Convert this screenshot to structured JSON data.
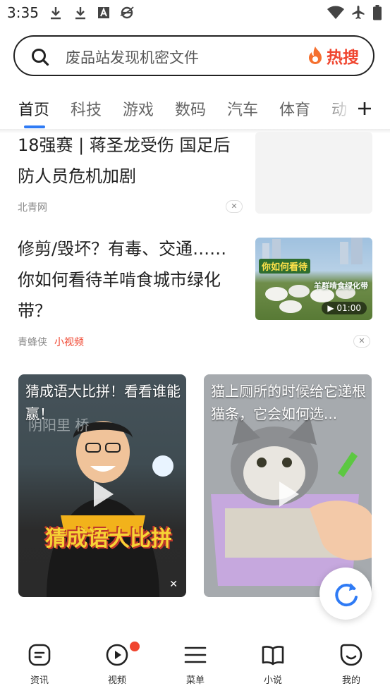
{
  "status_bar": {
    "time": "3:35",
    "left_icons": [
      "download-icon",
      "download-icon",
      "a-icon",
      "browser-icon"
    ],
    "right_icons": [
      "wifi-icon",
      "airplane-icon",
      "battery-icon"
    ]
  },
  "search": {
    "query": "废品站发现机密文件",
    "hot_label": "热搜",
    "accent": "#f0452f"
  },
  "tabs": {
    "items": [
      "首页",
      "科技",
      "游戏",
      "数码",
      "汽车",
      "体育",
      "动"
    ],
    "active": "首页",
    "active_color": "#2f7bf5"
  },
  "feed": {
    "article1": {
      "title": "18强赛 | 蒋圣龙受伤 国足后防人员危机加剧",
      "source": "北青网"
    },
    "article2": {
      "title": "修剪/毁坏？有毒、交通……你如何看待羊啃食城市绿化带？",
      "source": "青蜂侠",
      "tag": "小视频",
      "thumb_caption1": "你如何看待",
      "thumb_caption2": "羊群啃食绿化带",
      "duration": "01:00"
    },
    "video1": {
      "title": "猜成语大比拼！看看谁能赢！",
      "overlay_text": "猜成语大比拼",
      "board_text": "阴阳里 桥"
    },
    "video2": {
      "title": "猫上厕所的时候给它递根猫条，它会如何选..."
    }
  },
  "bottom_nav": {
    "items": [
      {
        "label": "资讯",
        "icon": "news-icon"
      },
      {
        "label": "视频",
        "icon": "video-play-icon"
      },
      {
        "label": "菜单",
        "icon": "menu-icon"
      },
      {
        "label": "小说",
        "icon": "book-icon"
      },
      {
        "label": "我的",
        "icon": "smile-icon"
      }
    ]
  }
}
